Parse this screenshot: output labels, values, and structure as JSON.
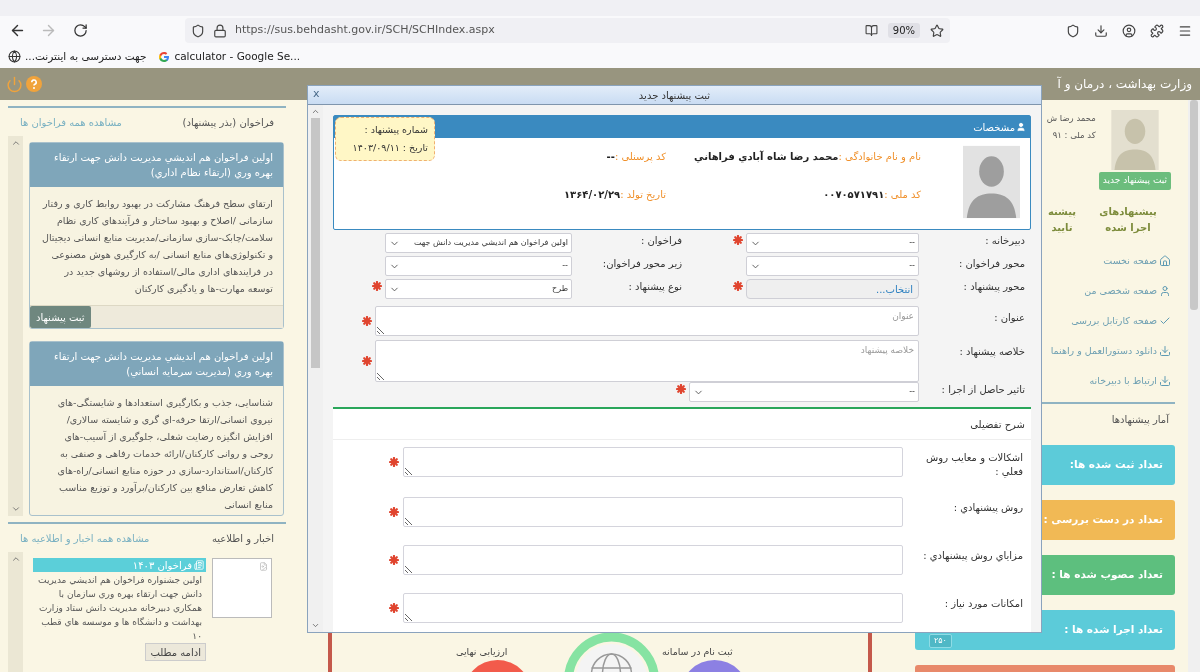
{
  "browser": {
    "url": "https://sus.behdasht.gov.ir/SCH/SCHIndex.aspx",
    "zoom": "90%",
    "forward_enabled": false,
    "bookmarks_bar": {
      "globe_bookmark": "جهت دسترسی به اینترنت...",
      "google_bookmark": "calculator - Google Se..."
    }
  },
  "header": {
    "title": "وزارت بهداشت ، درمان و آ"
  },
  "calls": {
    "title": "فراخوان (بذر پیشنهاد)",
    "link": "مشاهده همه فراخوان ها",
    "cards": [
      {
        "title": "اولین فراخوان هم اندیشي مدیریت دانش جهت ارتقاء بهره وري (ارتقاء نظام اداري)",
        "body": "ارتقای سطح فرهنگ مشارکت در بهبود روابط کاری و رفتار سازمانی /اصلاح و بهبود ساختار و فرآیندهای کاری نظام سلامت/چابک-سازی سازمانی/مدیریت منابع انسانی دیجیتال و تکنولوژی‌های منابع انسانی /به کارگیری هوش مصنوعی در فرایندهای اداری مالی/استفاده از روشهای جدید در توسعه مهارت-ها و یادگیری کارکنان",
        "button": "ثبت پیشنهاد"
      },
      {
        "title": "اولین فراخوان هم اندیشي مدیریت دانش جهت ارتقاء بهره وري (مدیریت سرمایه انساني)",
        "body": "شناسایی، جذب و بکارگیری استعدادها و شایستگی-های نیروی انسانی/ارتقا حرفه-ای گری و شایسته سالاری/ افزایش انگیزه رضایت شغلی، جلوگیری از آسیب-های روحی و روانی کارکنان/ارائه خدمات رفاهی و صنفی به کارکنان/استاندارد-سازی در حوزه منابع انسانی/راه-های کاهش تعارض منافع بین کارکنان/برآورد و توزیع مناسب منابع انسانی"
      }
    ]
  },
  "news": {
    "title": "اخبار و اطلاعیه",
    "link": "مشاهده همه اخبار و اطلاعیه ها",
    "items": [
      {
        "tag": "فراخوان ۱۴۰۳",
        "text": "اولین جشنواره فراخوان هم اندیشي مدیریت دانش جهت ارتقاء بهره وري سازمان با همکاري دبیرخانه مدیریت دانش ستاد وزارت بهداشت و دانشگاه ها و موسسه هاي قطب ۱۰",
        "button": "ادامه مطلب"
      }
    ]
  },
  "process": {
    "steps": [
      {
        "kind": "circle",
        "label": "ثبت نام در سامانه",
        "color": "#8c80e3"
      },
      {
        "kind": "globe",
        "color": "#86e3a2"
      },
      {
        "kind": "circle",
        "label": "ارزیابی نهایی",
        "color": "#f25b4b"
      }
    ]
  },
  "right": {
    "name_cut": "محمد رضا ش",
    "id_cut": "کد ملی : ۹۱",
    "new_button": "ثبت پیشنهاد جدید",
    "tiles": [
      {
        "label": "پیشنهادهای اجرا شده"
      },
      {
        "label": "پیشنه تایید"
      }
    ],
    "nav": [
      {
        "kind": "home",
        "label": "صفحه نخست"
      },
      {
        "kind": "user",
        "label": "صفحه شخصی من"
      },
      {
        "kind": "check",
        "label": "صفحه کارتابل بررسی"
      },
      {
        "kind": "download",
        "label": "دانلود دستورالعمل و راهنما"
      },
      {
        "kind": "download",
        "label": "ارتباط با دبیرخانه"
      }
    ],
    "stats_title": "آمار پیشنهادها",
    "stats": [
      {
        "label": "تعداد ثبت شده ها:",
        "color": "#5ccbd9"
      },
      {
        "label": "تعداد در دست بررسی :",
        "color": "#f1b955"
      },
      {
        "label": "تعداد مصوب شده ها :",
        "color": "#5dbf7e"
      },
      {
        "label": "تعداد اجرا شده ها :",
        "color": "#5ccbd9",
        "count": "۲۵۰"
      },
      {
        "color": "#e8896a"
      }
    ]
  },
  "modal": {
    "title": "ثبت پیشنهاد جدید",
    "close": "x",
    "profile": {
      "title": "مشخصات",
      "fields": [
        {
          "label": "نام و نام خانوادگی :",
          "value": "محمد رضا شاه آبادي فراهاني"
        },
        {
          "label": "کد پرسنلی :",
          "value": "--"
        },
        {
          "label": "کد ملی :",
          "value": "۰۰۷۰۵۷۱۷۹۱"
        },
        {
          "label": "تاریخ تولد :",
          "value": "۱۳۶۴/۰۲/۲۹"
        }
      ]
    },
    "ticket": {
      "number": "شماره پیشنهاد :",
      "date": "تاریخ : ۱۴۰۳/۰۹/۱۱"
    },
    "rows": [
      [
        {
          "kind": "select",
          "label": "دبیرخانه :",
          "value": "--",
          "required": true
        },
        {
          "kind": "select",
          "label": "فراخوان :",
          "value": "اولین فراخوان هم اندیشي مدیریت دانش جهت",
          "required": false
        }
      ],
      [
        {
          "kind": "select",
          "label": "محور فراخوان :",
          "value": "--",
          "required": false
        },
        {
          "kind": "select",
          "label": "زیر محور فراخوان:",
          "value": "--",
          "required": false
        }
      ],
      [
        {
          "kind": "picker",
          "label": "محور پیشنهاد :",
          "value": "انتخاب...",
          "required": true
        },
        {
          "kind": "select",
          "label": "نوع پیشنهاد :",
          "value": "طرح",
          "required": true
        }
      ],
      [
        {
          "kind": "textarea",
          "label": "عنوان :",
          "placeholder": "عنوان",
          "required": true
        }
      ],
      [
        {
          "kind": "textarea",
          "label": "خلاصه پیشنهاد :",
          "placeholder": "خلاصه پیشنهاد",
          "required": true,
          "tall": true
        }
      ],
      [
        {
          "kind": "select",
          "label": "تاثیر حاصل از اجرا :",
          "value": "--",
          "required": true
        }
      ]
    ],
    "details": {
      "title": "شرح تفضیلی",
      "fields": [
        {
          "label": "اشکالات و معایب روش فعلي :",
          "required": true
        },
        {
          "label": "روش پیشنهادي :",
          "required": true
        },
        {
          "label": "مزایاي روش پیشنهادي :",
          "required": true
        },
        {
          "label": "امکانات مورد نیاز :",
          "required": true
        }
      ]
    }
  }
}
